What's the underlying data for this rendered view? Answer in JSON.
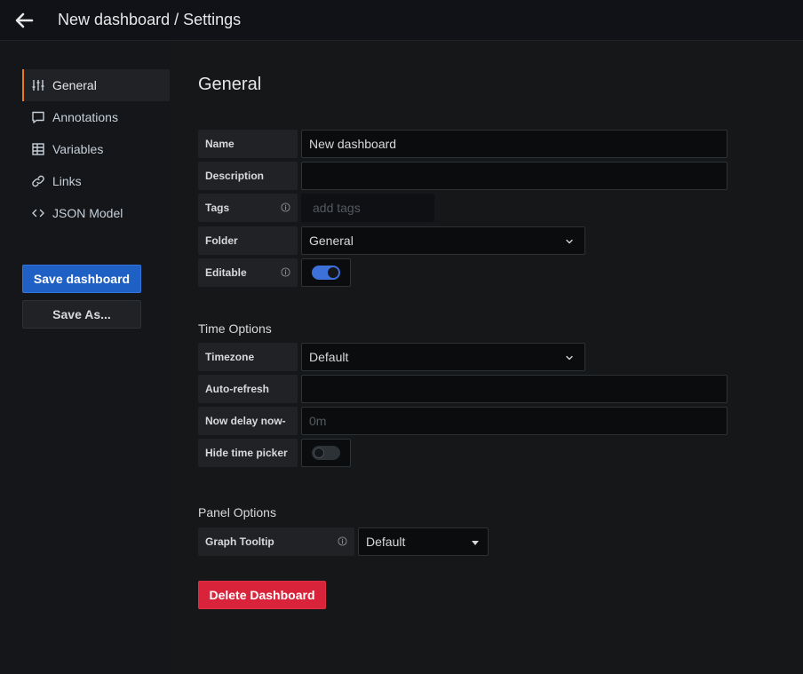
{
  "header": {
    "title": "New dashboard / Settings"
  },
  "sidebar": {
    "items": [
      {
        "label": "General",
        "icon": "sliders-icon"
      },
      {
        "label": "Annotations",
        "icon": "comment-icon"
      },
      {
        "label": "Variables",
        "icon": "table-icon"
      },
      {
        "label": "Links",
        "icon": "link-icon"
      },
      {
        "label": "JSON Model",
        "icon": "code-icon"
      }
    ],
    "save_label": "Save dashboard",
    "save_as_label": "Save As..."
  },
  "general": {
    "title": "General",
    "name": {
      "label": "Name",
      "value": "New dashboard"
    },
    "description": {
      "label": "Description",
      "value": ""
    },
    "tags": {
      "label": "Tags",
      "placeholder": "add tags"
    },
    "folder": {
      "label": "Folder",
      "value": "General"
    },
    "editable": {
      "label": "Editable",
      "on": true
    }
  },
  "time_options": {
    "title": "Time Options",
    "timezone": {
      "label": "Timezone",
      "value": "Default"
    },
    "auto_refresh": {
      "label": "Auto-refresh",
      "value": ""
    },
    "now_delay": {
      "label": "Now delay now-",
      "placeholder": "0m"
    },
    "hide_time_picker": {
      "label": "Hide time picker",
      "on": false
    }
  },
  "panel_options": {
    "title": "Panel Options",
    "graph_tooltip": {
      "label": "Graph Tooltip",
      "value": "Default"
    }
  },
  "delete_label": "Delete Dashboard",
  "colors": {
    "accent": "#eb7b18",
    "primary": "#1f60c4",
    "danger": "#d9233a",
    "switch_on": "#3d71d9"
  }
}
